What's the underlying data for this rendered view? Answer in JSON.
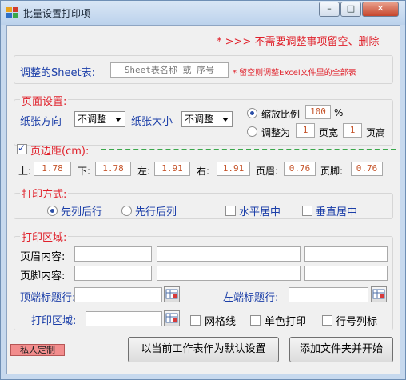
{
  "window": {
    "title": "批量设置打印项",
    "controls": [
      "–",
      "□",
      "✕"
    ]
  },
  "header_note": "* >>> 不需要调整事项留空、删除",
  "sheet": {
    "label": "调整的Sheet表:",
    "placeholder": "Sheet表名称 或 序号",
    "note": "* 留空则调整Excel文件里的全部表"
  },
  "page_setup": {
    "label": "页面设置:",
    "orientation_label": "纸张方向",
    "orientation_value": "不调整",
    "size_label": "纸张大小",
    "size_value": "不调整",
    "scale_label": "缩放比例",
    "scale_value": "100",
    "scale_unit": "%",
    "fit_label": "调整为",
    "fit_wide_value": "1",
    "fit_wide_label": "页宽",
    "fit_tall_value": "1",
    "fit_tall_label": "页高"
  },
  "margins": {
    "label": "页边距(cm):",
    "checked": true,
    "items": [
      {
        "label": "上:",
        "value": "1.78"
      },
      {
        "label": "下:",
        "value": "1.78"
      },
      {
        "label": "左:",
        "value": "1.91"
      },
      {
        "label": "右:",
        "value": "1.91"
      },
      {
        "label": "页眉:",
        "value": "0.76"
      },
      {
        "label": "页脚:",
        "value": "0.76"
      }
    ]
  },
  "print_method": {
    "label": "打印方式:",
    "order_down_then_over": "先列后行",
    "order_over_then_down": "先行后列",
    "center_horizontal": "水平居中",
    "center_vertical": "垂直居中"
  },
  "print_area": {
    "label": "打印区域:",
    "header_label": "页眉内容:",
    "footer_label": "页脚内容:",
    "title_rows_label": "顶端标题行:",
    "title_cols_label": "左端标题行:",
    "area_label": "打印区域:",
    "gridlines": "网格线",
    "mono": "单色打印",
    "row_col_headers": "行号列标"
  },
  "buttons": {
    "custom": "私人定制",
    "set_default": "以当前工作表作为默认设置",
    "add_folder": "添加文件夹并开始"
  },
  "colors": {
    "accent_red": "#e0202a",
    "label_blue": "#1b3ea8",
    "value_orange": "#c5542a",
    "dash_green": "#3aa84b",
    "pink_button": "#f28d8d"
  }
}
